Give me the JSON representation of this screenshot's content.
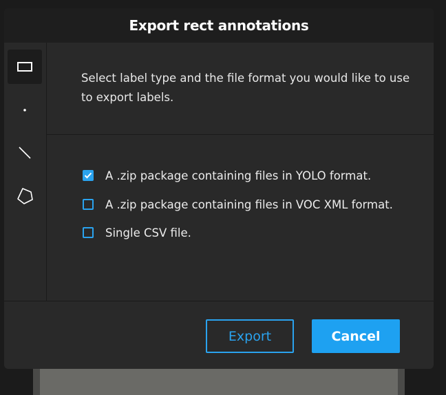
{
  "dialog": {
    "title": "Export rect annotations",
    "description": "Select label type and the file format you would like to use to export labels."
  },
  "sidebar": {
    "tools": [
      {
        "icon": "rectangle-icon",
        "active": true
      },
      {
        "icon": "point-icon",
        "active": false
      },
      {
        "icon": "line-icon",
        "active": false
      },
      {
        "icon": "polygon-icon",
        "active": false
      }
    ]
  },
  "options": [
    {
      "label": "A .zip package containing files in YOLO format.",
      "checked": true
    },
    {
      "label": "A .zip package containing files in VOC XML format.",
      "checked": false
    },
    {
      "label": "Single CSV file.",
      "checked": false
    }
  ],
  "footer": {
    "export_label": "Export",
    "cancel_label": "Cancel"
  },
  "colors": {
    "accent": "#2aa3ef",
    "dialog_background": "#292929",
    "header_background": "#1e1e1e"
  }
}
